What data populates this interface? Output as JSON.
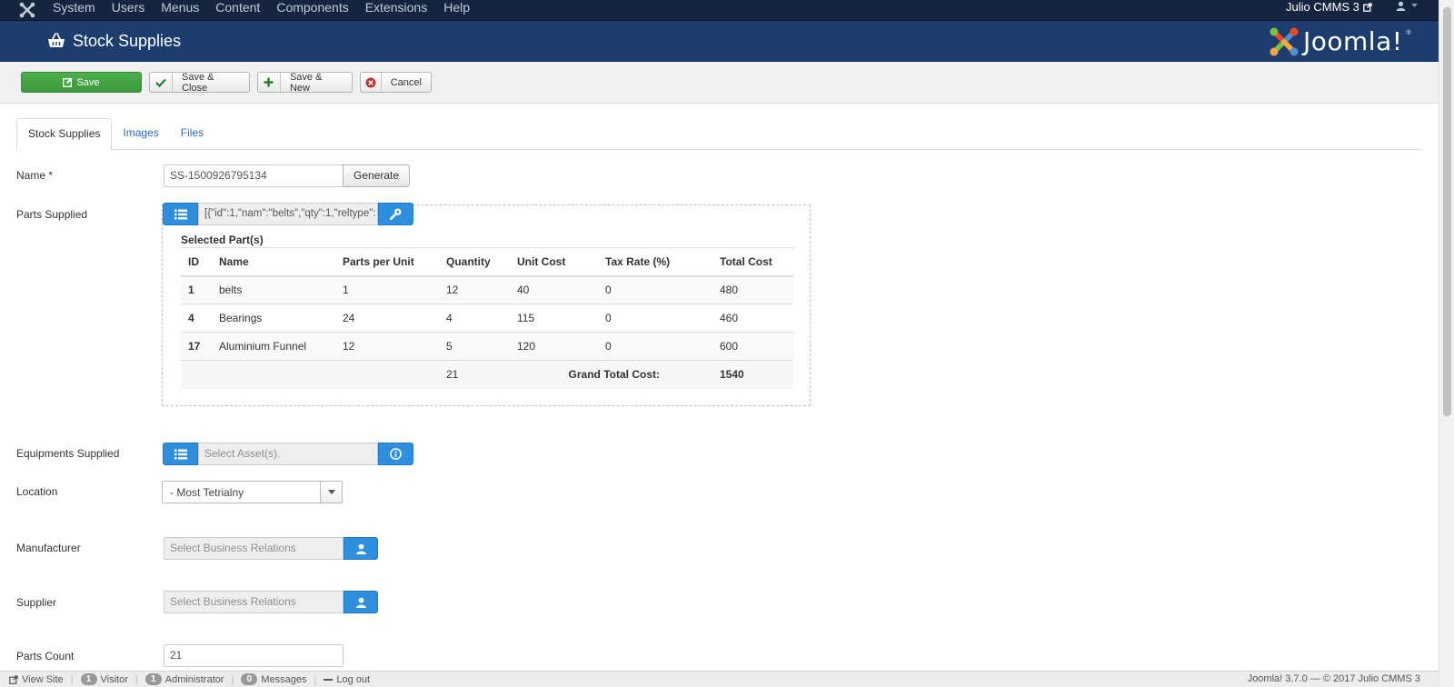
{
  "topnav": {
    "menu": [
      "System",
      "Users",
      "Menus",
      "Content",
      "Components",
      "Extensions",
      "Help"
    ],
    "site_name": "Julio CMMS 3"
  },
  "header": {
    "title": "Stock Supplies",
    "brand": "Joomla!"
  },
  "toolbar": {
    "save": "Save",
    "save_close": "Save & Close",
    "save_new": "Save & New",
    "cancel": "Cancel"
  },
  "tabs": [
    "Stock Supplies",
    "Images",
    "Files"
  ],
  "form": {
    "name": {
      "label": "Name *",
      "value": "SS-1500926795134",
      "generate": "Generate"
    },
    "parts_supplied": {
      "label": "Parts Supplied",
      "value": "[{\"id\":1,\"nam\":\"belts\",\"qty\":1,\"reltype\":",
      "heading": "Selected Part(s)",
      "columns": [
        "ID",
        "Name",
        "Parts per Unit",
        "Quantity",
        "Unit Cost",
        "Tax Rate (%)",
        "Total Cost"
      ],
      "rows": [
        [
          "1",
          "belts",
          "1",
          "12",
          "40",
          "0",
          "480"
        ],
        [
          "4",
          "Bearings",
          "24",
          "4",
          "115",
          "0",
          "460"
        ],
        [
          "17",
          "Aluminium Funnel",
          "12",
          "5",
          "120",
          "0",
          "600"
        ]
      ],
      "total_quantity": "21",
      "grand_total_label": "Grand Total Cost:",
      "grand_total": "1540"
    },
    "equipments_supplied": {
      "label": "Equipments Supplied",
      "placeholder": "Select Asset(s)."
    },
    "location": {
      "label": "Location",
      "value": "- Most Tetrialny"
    },
    "manufacturer": {
      "label": "Manufacturer",
      "placeholder": "Select Business Relations"
    },
    "supplier": {
      "label": "Supplier",
      "placeholder": "Select Business Relations"
    },
    "parts_count": {
      "label": "Parts Count",
      "value": "21"
    }
  },
  "footer": {
    "view_site": "View Site",
    "visitor_count": "1",
    "visitor_label": "Visitor",
    "admin_count": "1",
    "admin_label": "Administrator",
    "messages_count": "0",
    "messages_label": "Messages",
    "logout": "Log out",
    "version": "Joomla! 3.7.0 — © 2017 Julio CMMS 3"
  },
  "colors": {
    "topnav": "#16253f",
    "header": "#1c3d6e",
    "save_button": "#46a546",
    "accent_blue": "#2d8fde",
    "link": "#2a6db5"
  },
  "icons": {
    "brand": "joomla-logo-icon",
    "title": "basket-icon",
    "save": "edit-icon",
    "save_close": "check-icon",
    "save_new": "plus-icon",
    "cancel": "cancel-icon",
    "list": "list-icon",
    "wrench": "wrench-icon",
    "info": "info-icon",
    "user": "user-icon",
    "external": "external-link-icon"
  }
}
